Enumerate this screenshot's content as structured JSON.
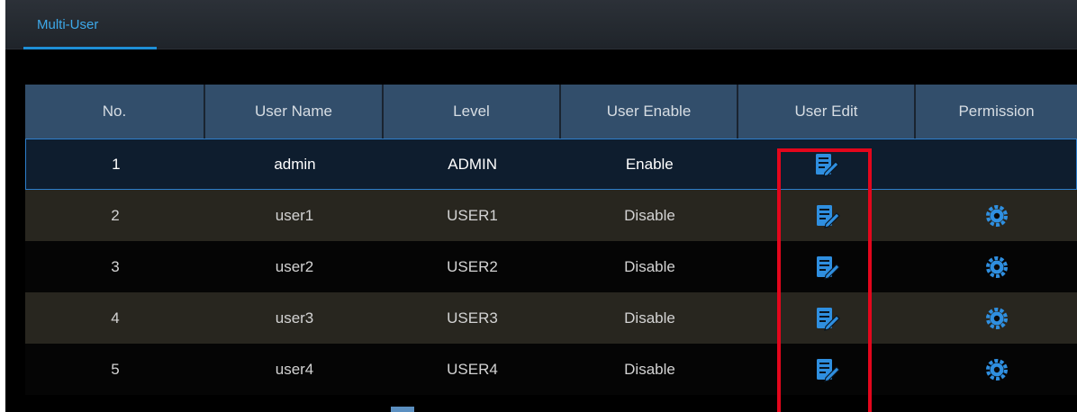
{
  "tabs": [
    {
      "label": "Multi-User",
      "active": true
    }
  ],
  "table": {
    "columns": [
      "No.",
      "User Name",
      "Level",
      "User Enable",
      "User Edit",
      "Permission"
    ],
    "rows": [
      {
        "no": "1",
        "user_name": "admin",
        "level": "ADMIN",
        "enable": "Enable",
        "edit_icon": "edit-icon",
        "permission_icon": null,
        "selected": true
      },
      {
        "no": "2",
        "user_name": "user1",
        "level": "USER1",
        "enable": "Disable",
        "edit_icon": "edit-icon",
        "permission_icon": "gear-icon",
        "selected": false
      },
      {
        "no": "3",
        "user_name": "user2",
        "level": "USER2",
        "enable": "Disable",
        "edit_icon": "edit-icon",
        "permission_icon": "gear-icon",
        "selected": false
      },
      {
        "no": "4",
        "user_name": "user3",
        "level": "USER3",
        "enable": "Disable",
        "edit_icon": "edit-icon",
        "permission_icon": "gear-icon",
        "selected": false
      },
      {
        "no": "5",
        "user_name": "user4",
        "level": "USER4",
        "enable": "Disable",
        "edit_icon": "edit-icon",
        "permission_icon": "gear-icon",
        "selected": false
      }
    ]
  },
  "colors": {
    "accent": "#1e8fd6",
    "header_bg": "#324e6b",
    "selected_border": "#2d7ecb",
    "highlight": "#e3061c",
    "icon": "#2f8fe0"
  }
}
